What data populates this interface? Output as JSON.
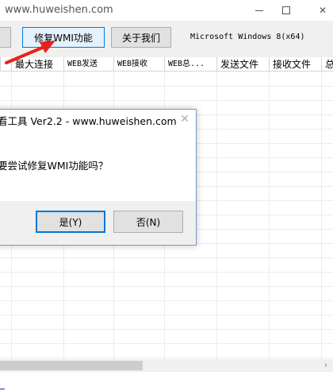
{
  "window": {
    "title": "www.huweishen.com",
    "close_glyph": "✕"
  },
  "toolbar": {
    "repair_label": "修复WMI功能",
    "about_label": "关于我们",
    "os_label": "Microsoft Windows 8(x64)"
  },
  "list": {
    "columns": [
      "最大连接",
      "WEB发送",
      "WEB接收",
      "WEB总...",
      "发送文件",
      "接收文件",
      "总"
    ]
  },
  "dialog": {
    "title": "看工具 Ver2.2 - www.huweishen.com",
    "message": "要尝试修复WMI功能吗？",
    "yes_label": "是(Y)",
    "no_label": "否(N)",
    "close_glyph": "✕"
  },
  "scrollbar": {
    "right_arrow": "›"
  },
  "colors": {
    "accent": "#0078d7",
    "arrow": "#e8221b"
  }
}
